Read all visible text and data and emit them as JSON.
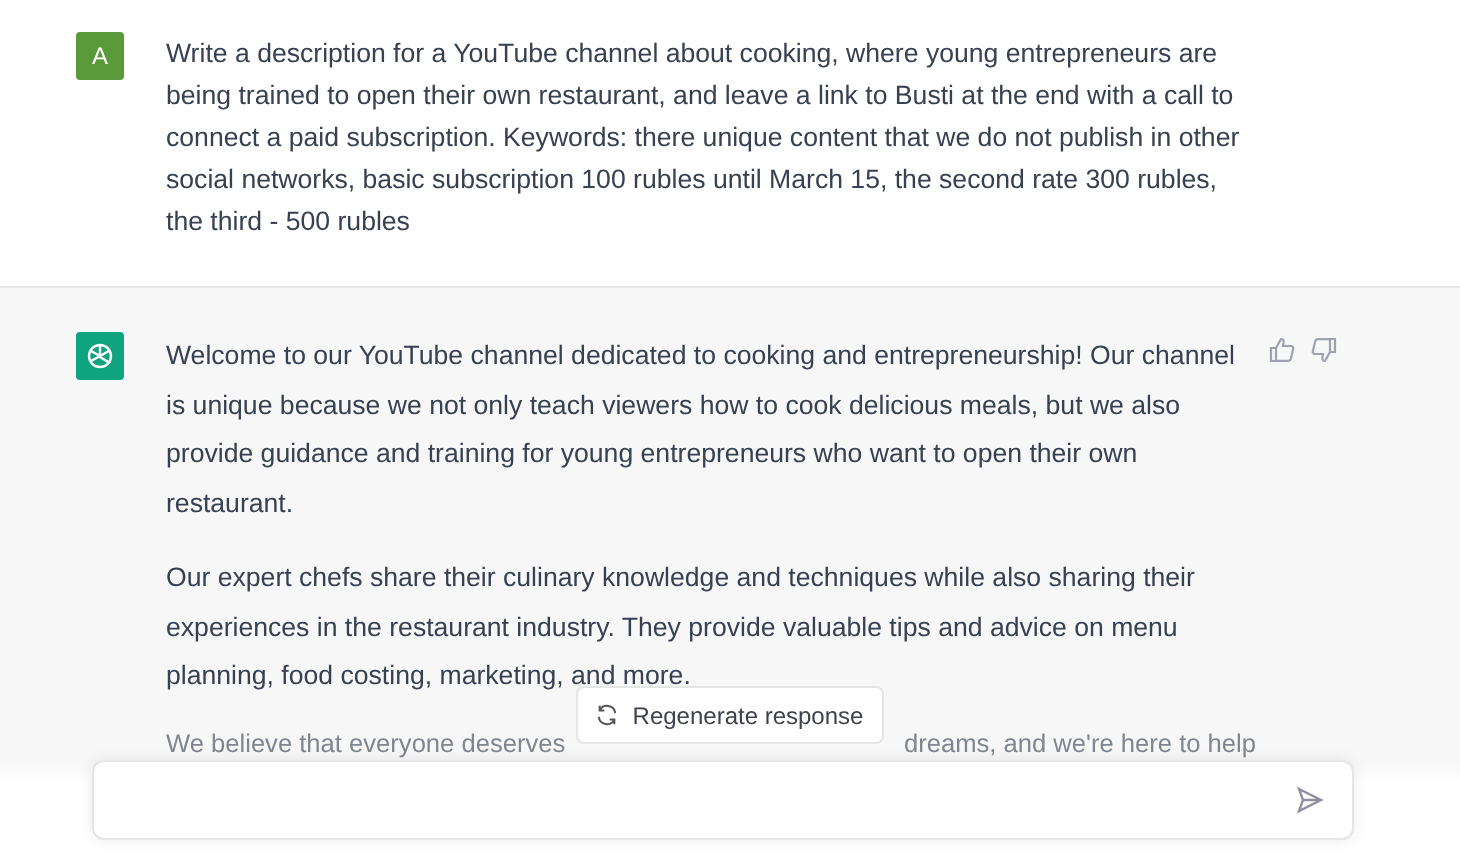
{
  "messages": [
    {
      "kind": "user",
      "avatar": "A",
      "paragraphs": [
        "Write a description for a YouTube channel about cooking, where young entrepreneurs are being trained to open their own restaurant, and leave a link to Busti at the end with a call to connect a paid subscription. Keywords: there unique content that we do not publish in other social networks, basic subscription 100 rubles until March 15, the second rate 300 rubles, the third - 500 rubles"
      ]
    },
    {
      "kind": "assistant",
      "paragraphs": [
        "Welcome to our YouTube channel dedicated to cooking and entrepreneurship! Our channel is unique because we not only teach viewers how to cook delicious meals, but we also provide guidance and training for young entrepreneurs who want to open their own restaurant.",
        "Our expert chefs share their culinary knowledge and techniques while also sharing their experiences in the restaurant industry. They provide valuable tips and advice on menu planning, food costing, marketing, and more."
      ],
      "faded_line": [
        "We believe that everyone deserves",
        "dreams, and we're here to help"
      ]
    }
  ],
  "regenerate_button": {
    "label": "Regenerate response"
  }
}
